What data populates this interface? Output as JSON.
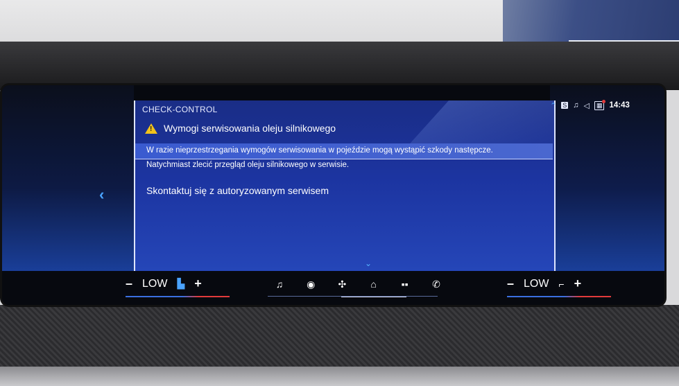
{
  "status_bar": {
    "icons": [
      "chevron-up-icon",
      "sim-icon",
      "music-note-icon",
      "volume-icon",
      "calendar-icon"
    ],
    "time": "14:43"
  },
  "check_control": {
    "title": "CHECK-CONTROL",
    "warning_title": "Wymogi serwisowania oleju silnikowego",
    "description_line1": "W razie nieprzestrzegania wymogów serwisowania w pojeździe mogą wystąpić szkody następcze.",
    "description_line2": "Natychmiast zlecić przegląd oleju silnikowego w serwisie.",
    "contact_label": "Skontaktuj się z autoryzowanym serwisem"
  },
  "climate_left": {
    "minus": "–",
    "level": "LOW",
    "plus": "+"
  },
  "climate_right": {
    "minus": "–",
    "level": "LOW",
    "plus": "+"
  },
  "nav": {
    "items": [
      "music-icon",
      "navigation-icon",
      "fan-icon",
      "home-icon",
      "apps-icon",
      "phone-icon"
    ],
    "active": "home-icon"
  },
  "colors": {
    "accent": "#4aa3ff",
    "warning": "#f2c21b",
    "heat": "#e23b3b",
    "panel": "#1c34a0"
  }
}
